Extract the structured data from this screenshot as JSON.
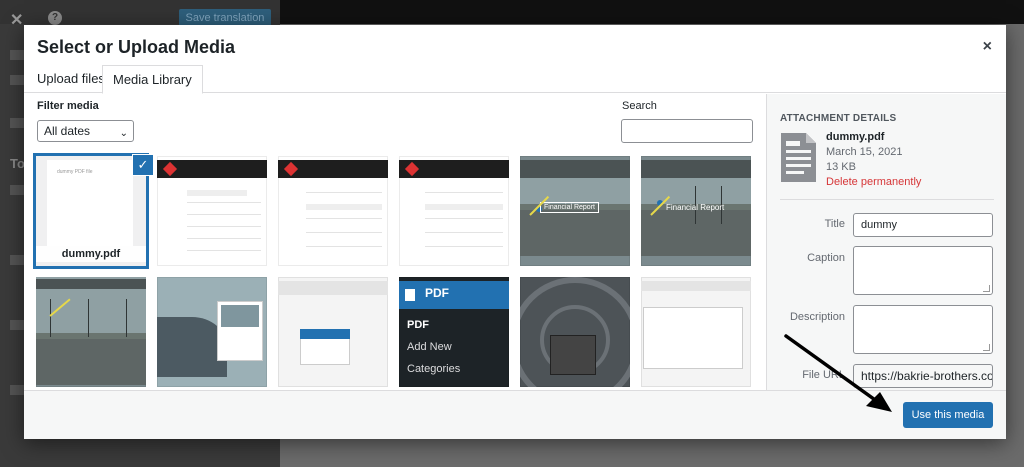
{
  "background": {
    "save_translation_label": "Save translation",
    "help_glyph": "?",
    "close_glyph": "✕",
    "sidebar_letter": "To"
  },
  "modal": {
    "title": "Select or Upload Media",
    "close_glyph": "×",
    "tabs": [
      {
        "label": "Upload files",
        "active": false
      },
      {
        "label": "Media Library",
        "active": true
      }
    ]
  },
  "filter": {
    "label": "Filter media",
    "selected": "All dates",
    "search_label": "Search",
    "search_value": ""
  },
  "grid": {
    "items": [
      {
        "type": "document",
        "name": "dummy.pdf",
        "selected": true,
        "page_title": "dummy PDF file"
      },
      {
        "type": "web-screenshot"
      },
      {
        "type": "web-screenshot"
      },
      {
        "type": "web-screenshot"
      },
      {
        "type": "road-image",
        "label": "Financial Report"
      },
      {
        "type": "road-image",
        "label": "Financial Report"
      },
      {
        "type": "road-image-nav"
      },
      {
        "type": "ship-image"
      },
      {
        "type": "ui-screenshot"
      },
      {
        "type": "admin-menu",
        "header": "PDF",
        "menu": [
          "PDF",
          "Add New",
          "Categories"
        ]
      },
      {
        "type": "tunnel-image"
      },
      {
        "type": "ui-screenshot"
      }
    ],
    "check_glyph": "✓"
  },
  "details": {
    "heading": "ATTACHMENT DETAILS",
    "filename": "dummy.pdf",
    "date": "March 15, 2021",
    "size": "13 KB",
    "delete_label": "Delete permanently",
    "fields": {
      "title_label": "Title",
      "title_value": "dummy",
      "caption_label": "Caption",
      "caption_value": "",
      "description_label": "Description",
      "description_value": "",
      "file_url_label": "File URL",
      "file_url_value": "https://bakrie-brothers.co"
    }
  },
  "footer": {
    "use_button": "Use this media"
  },
  "colors": {
    "accent": "#2271b1",
    "danger": "#d63638",
    "annotation": "#000000"
  }
}
